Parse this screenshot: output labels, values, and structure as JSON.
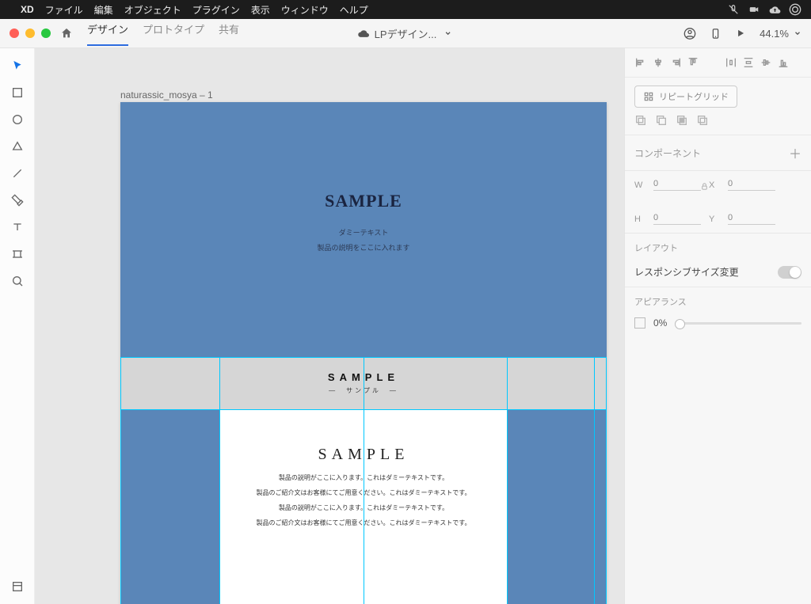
{
  "menubar": {
    "app": "XD",
    "items": [
      "ファイル",
      "編集",
      "オブジェクト",
      "プラグイン",
      "表示",
      "ウィンドウ",
      "ヘルプ"
    ]
  },
  "topbar": {
    "modes": {
      "design": "デザイン",
      "prototype": "プロトタイプ",
      "share": "共有"
    },
    "doc_title": "LPデザイン...",
    "zoom": "44.1%"
  },
  "artboard": {
    "label": "naturassic_mosya – 1",
    "hero": {
      "title": "SAMPLE",
      "sub1": "ダミーテキスト",
      "sub2": "製品の説明をここに入れます"
    },
    "band": {
      "title": "SAMPLE",
      "subtitle": "—　サンプル　—"
    },
    "section2": {
      "title": "SAMPLE",
      "lines": [
        "製品の説明がここに入ります。これはダミーテキストです。",
        "製品のご紹介文はお客様にてご用意ください。これはダミーテキストです。",
        "製品の説明がここに入ります。これはダミーテキストです。",
        "製品のご紹介文はお客様にてご用意ください。これはダミーテキストです。"
      ]
    }
  },
  "panel": {
    "repeat_grid": "リピートグリッド",
    "component": "コンポーネント",
    "w_label": "W",
    "x_label": "X",
    "h_label": "H",
    "y_label": "Y",
    "w": "0",
    "x": "0",
    "h": "0",
    "y": "0",
    "layout": "レイアウト",
    "responsive": "レスポンシブサイズ変更",
    "appearance": "アピアランス",
    "opacity": "0%"
  }
}
